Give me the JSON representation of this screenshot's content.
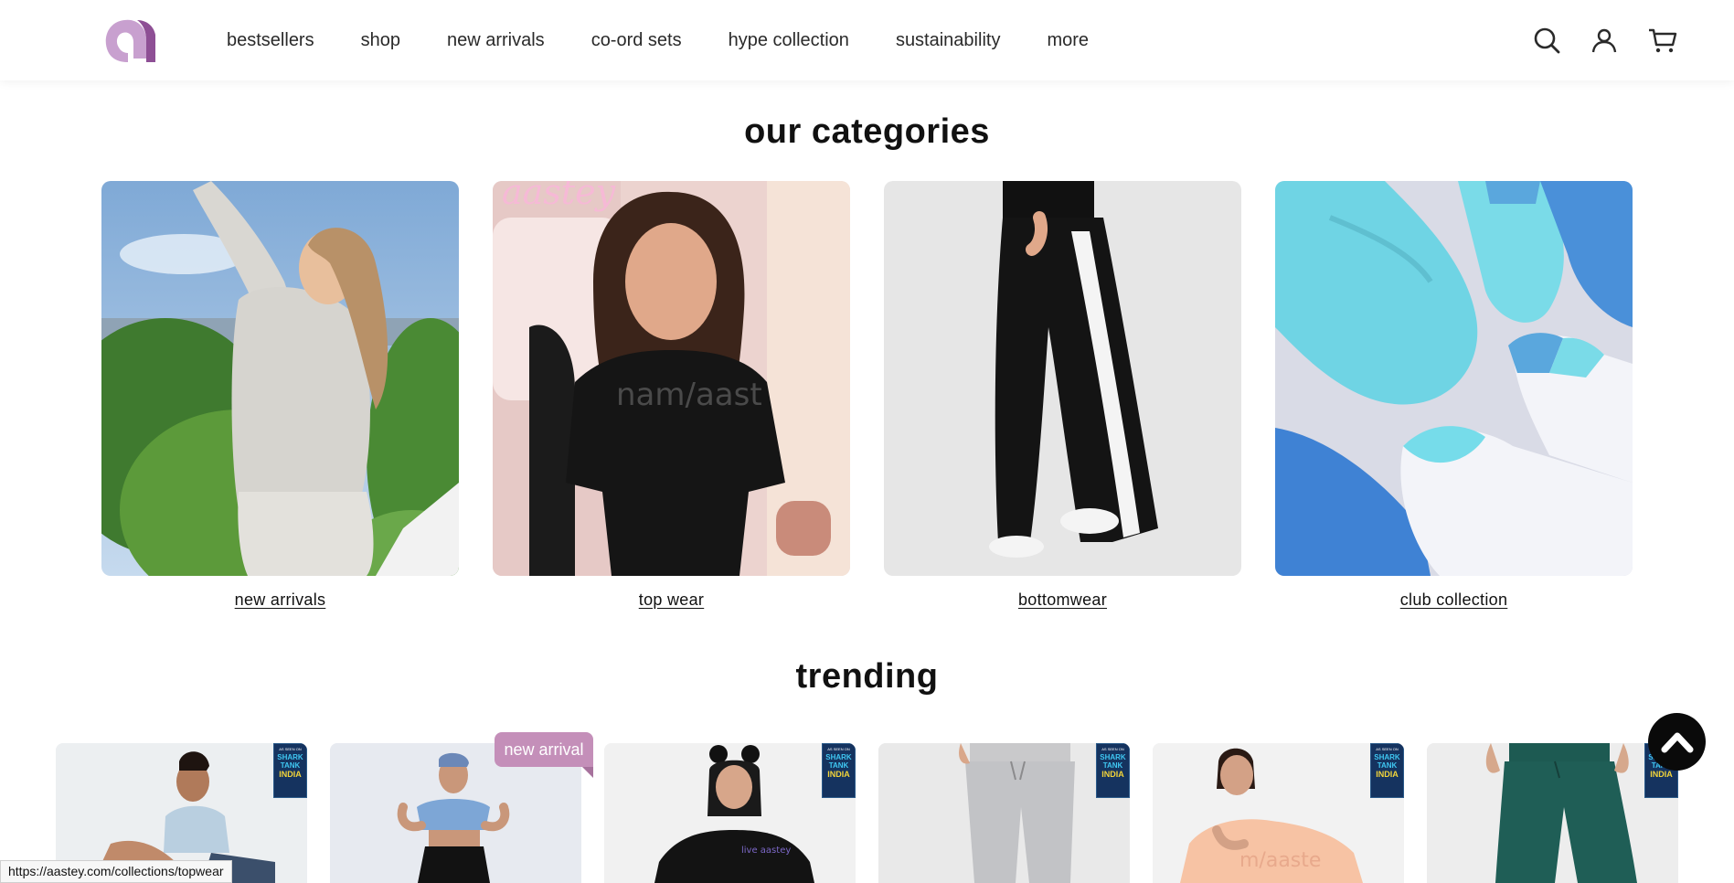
{
  "header": {
    "logo_icon": "aastey-logo",
    "nav": [
      "bestsellers",
      "shop",
      "new arrivals",
      "co-ord sets",
      "hype collection",
      "sustainability",
      "more"
    ],
    "icons": [
      "search-icon",
      "account-icon",
      "cart-icon"
    ]
  },
  "categories": {
    "title": "our categories",
    "items": [
      {
        "label": "new arrivals"
      },
      {
        "label": "top wear"
      },
      {
        "label": "bottomwear"
      },
      {
        "label": "club collection"
      }
    ]
  },
  "trending": {
    "title": "trending",
    "badge": {
      "small": "AS SEEN ON",
      "line1": "SHARK",
      "line2": "TANK",
      "line3": "INDIA"
    },
    "new_badge": "new arrival"
  },
  "status_bar": {
    "url": "https://aastey.com/collections/topwear"
  },
  "colors": {
    "brand": "#c48fb9",
    "brand_dark": "#8e4f95",
    "shark_blue": "#15335f"
  }
}
